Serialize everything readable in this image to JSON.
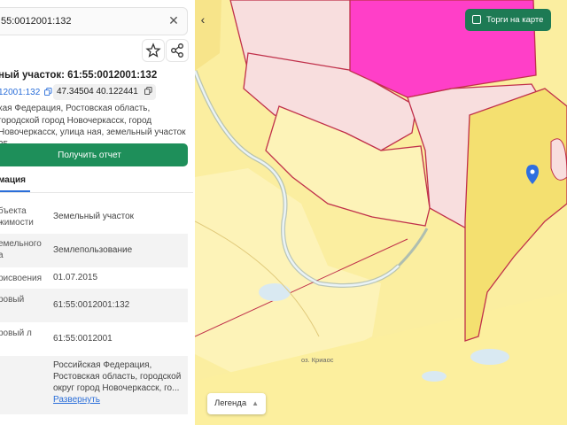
{
  "search": {
    "value": "55:0012001:132",
    "close_icon": "close-icon"
  },
  "actions": {
    "favorite_icon": "star-icon",
    "share_icon": "share-icon"
  },
  "parcel": {
    "title": "ный участок: 61:55:0012001:132",
    "cadastral_link": "12001:132",
    "coordinates": "47.34504 40.122441",
    "address": "кая Федерация, Ростовская область, городской город Новочеркасск, город Новочеркасск, улица ная, земельный участок 35"
  },
  "report_button": "Получить отчет",
  "tab_label": "мация",
  "info_rows": [
    {
      "key": "бъекта жимости",
      "value": "Земельный участок"
    },
    {
      "key": "емельного а",
      "value": "Землепользование"
    },
    {
      "key": "рисвоения",
      "value": "01.07.2015"
    },
    {
      "key": "ровый",
      "value": "61:55:0012001:132"
    },
    {
      "key": "ровый л",
      "value": "61:55:0012001"
    },
    {
      "key": "",
      "value": "Российская Федерация, Ростовская область, городской округ город Новочеркасск, го..."
    }
  ],
  "expand_link": "Развернуть",
  "map": {
    "torgi_label": "Торги на карте",
    "legend_label": "Легенда",
    "place_label": "оз. Криаос",
    "colors": {
      "yellow": "#fbeea0",
      "pink_fill": "#f8dede",
      "magenta": "#ff3fc8",
      "border": "#c0304a",
      "marker": "#2f6fe0",
      "water": "#d9e9f2"
    }
  }
}
